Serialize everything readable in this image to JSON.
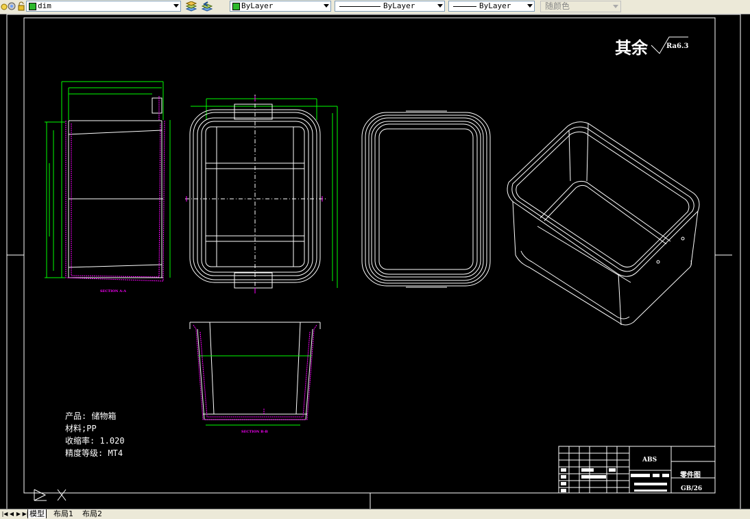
{
  "toolbar": {
    "layer_name": "dim",
    "color_control": "ByLayer",
    "linetype_control": "ByLayer",
    "lineweight_control": "ByLayer",
    "plotstyle_control": "随颜色"
  },
  "drawing": {
    "roughness_label": "其余",
    "roughness_value": "Ra6.3",
    "section_a_label": "SECTION A-A",
    "section_b_label": "SECTION B-B",
    "notes": {
      "product": "产品: 储物箱",
      "material": "材料;PP",
      "shrinkage": "收缩率: 1.020",
      "precision": "精度等级: MT4"
    },
    "title_block": {
      "material_code": "ABS",
      "drawing_type": "零件图",
      "sheet": "GB/26"
    }
  },
  "tabs": {
    "model": "模型",
    "layout1": "布局1",
    "layout2": "布局2"
  },
  "colors": {
    "background": "#000000",
    "geometry": "#ffffff",
    "dimension": "#00ff00",
    "hatch": "#ff00ff",
    "layer_swatch": "#2db82d"
  }
}
